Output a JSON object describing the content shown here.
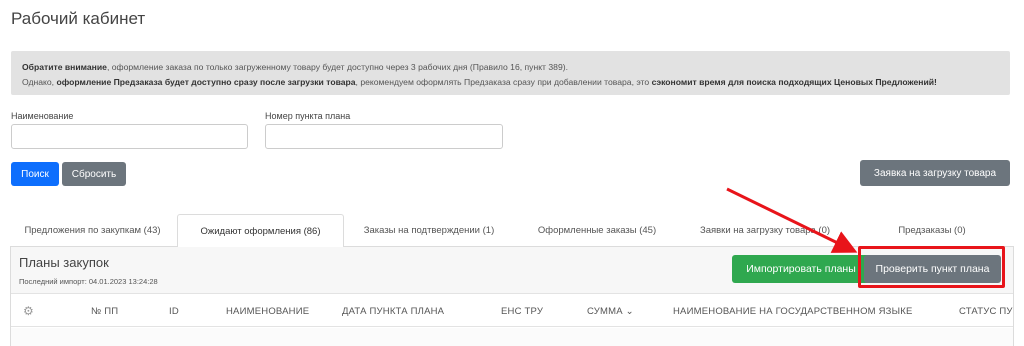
{
  "page": {
    "title": "Рабочий кабинет"
  },
  "notice": {
    "line1_bold": "Обратите внимание",
    "line1_rest": ", оформление заказа по только загруженному товару будет доступно через 3 рабочих дня (Правило 16, пункт 389).",
    "line2_a": "Однако, ",
    "line2_bold1": "оформление Предзаказа будет доступно сразу после загрузки товара",
    "line2_b": ", рекомендуем оформлять Предзаказа сразу при добавлении товара, это ",
    "line2_bold2": "сэкономит время для поиска подходящих Ценовых Предложений!"
  },
  "filters": {
    "name_label": "Наименование",
    "name_value": "",
    "plan_label": "Номер пункта плана",
    "plan_value": ""
  },
  "buttons": {
    "search": "Поиск",
    "reset": "Сбросить",
    "upload_request": "Заявка на загрузку товара",
    "import_plans": "Импортировать планы",
    "check_plan_item": "Проверить пункт плана"
  },
  "tabs": [
    {
      "label": "Предложения по закупкам (43)"
    },
    {
      "label": "Ожидают оформления (86)",
      "active": true
    },
    {
      "label": "Заказы на подтверждении (1)"
    },
    {
      "label": "Оформленные заказы (45)"
    },
    {
      "label": "Заявки на загрузку товара (0)"
    },
    {
      "label": "Предзаказы (0)"
    }
  ],
  "panel": {
    "title": "Планы закупок",
    "last_import": "Последний импорт: 04.01.2023 13:24:28"
  },
  "table": {
    "columns": [
      {
        "label": "⚙",
        "icon": "gear-icon"
      },
      {
        "label": "№ ПП"
      },
      {
        "label": "ID"
      },
      {
        "label": "НАИМЕНОВАНИЕ"
      },
      {
        "label": "ДАТА ПУНКТА ПЛАНА"
      },
      {
        "label": "ЕНС ТРУ"
      },
      {
        "label": "СУММА ⌄",
        "sortable": true
      },
      {
        "label": "НАИМЕНОВАНИЕ НА ГОСУДАРСТВЕННОМ ЯЗЫКЕ"
      },
      {
        "label": "СТАТУС ПУ"
      }
    ]
  },
  "colors": {
    "primary": "#0d6efd",
    "secondary": "#6c757d",
    "success": "#2fa84f",
    "annotation": "#e8141a"
  },
  "annotation": {
    "target": "check-plan-item-button",
    "shape": "red-rectangle-with-arrow"
  }
}
